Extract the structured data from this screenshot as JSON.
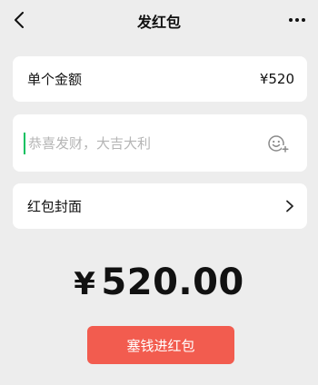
{
  "nav": {
    "title": "发红包",
    "back_icon": "chevron-left-icon",
    "more_icon": "more-horizontal-icon"
  },
  "amount_row": {
    "label": "单个金额",
    "value": "¥520"
  },
  "greeting": {
    "placeholder": "恭喜发财，大吉大利",
    "value": "",
    "emoji_icon": "emoji-add-icon"
  },
  "cover_row": {
    "label": "红包封面",
    "chevron_icon": "chevron-right-icon"
  },
  "total": {
    "currency": "¥",
    "amount": "520.00"
  },
  "send_button": {
    "label": "塞钱进红包",
    "color": "#f25c4f"
  }
}
